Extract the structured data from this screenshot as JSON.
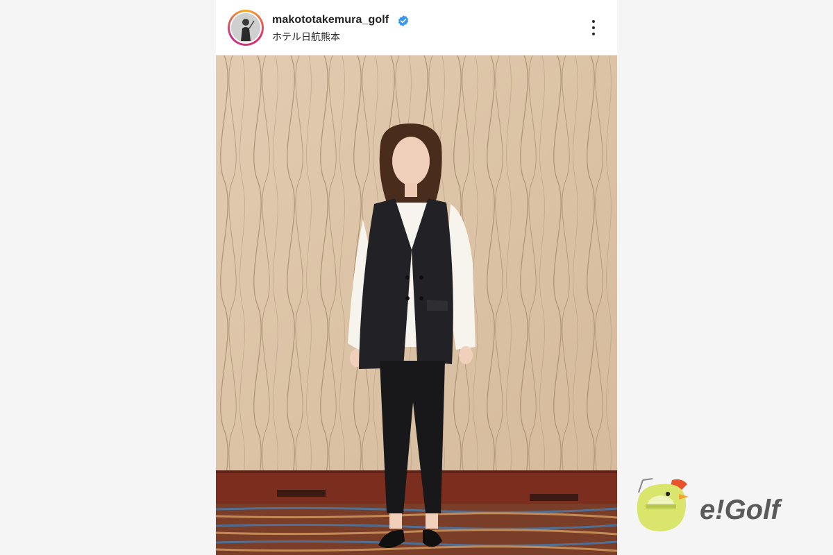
{
  "post": {
    "username": "makototakemura_golf",
    "verified": true,
    "location": "ホテル日航熊本",
    "more_icon": "more-vertical-icon"
  },
  "watermark": {
    "brand": "e!Golf",
    "mascot_icon": "bird-mascot-icon"
  },
  "colors": {
    "verified_blue": "#3897f0",
    "logo_green": "#d9e66b",
    "logo_gray": "#5a5a5a"
  }
}
